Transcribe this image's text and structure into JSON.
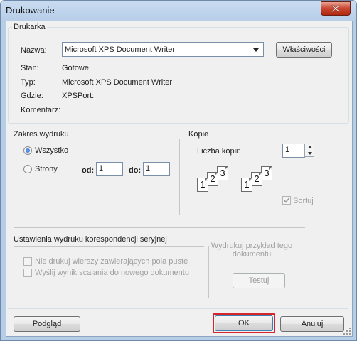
{
  "window": {
    "title": "Drukowanie"
  },
  "printer": {
    "group_label": "Drukarka",
    "name_label": "Nazwa:",
    "name_value": "Microsoft XPS Document Writer",
    "properties_button": "Właściwości",
    "status_label": "Stan:",
    "status_value": "Gotowe",
    "type_label": "Typ:",
    "type_value": "Microsoft XPS Document Writer",
    "where_label": "Gdzie:",
    "where_value": "XPSPort:",
    "comment_label": "Komentarz:",
    "comment_value": ""
  },
  "range": {
    "group_label": "Zakres wydruku",
    "all_label": "Wszystko",
    "all_checked": true,
    "pages_label": "Strony",
    "from_label": "od:",
    "from_value": "1",
    "to_label": "do:",
    "to_value": "1"
  },
  "copies": {
    "group_label": "Kopie",
    "count_label": "Liczba kopii:",
    "count_value": "1",
    "collate_label": "Sortuj",
    "collate_checked": true,
    "page_numbers": [
      "1",
      "2",
      "3"
    ]
  },
  "merge": {
    "group_label": "Ustawienia wydruku korespondencji seryjnej",
    "skip_empty_label": "Nie drukuj wierszy zawierających pola puste",
    "output_new_doc_label": "Wyślij wynik scalania do nowego dokumentu",
    "sample_label_line1": "Wydrukuj przykład tego",
    "sample_label_line2": "dokumentu",
    "test_button": "Testuj"
  },
  "footer": {
    "preview_button": "Podgląd",
    "ok_button": "OK",
    "cancel_button": "Anuluj"
  },
  "colors": {
    "ok_highlight": "#d8242c",
    "radio_selected": "#1b5fc4"
  },
  "icons": [
    "close-icon",
    "dropdown-arrow-icon",
    "collate-pages-icon",
    "resize-grip-icon"
  ]
}
